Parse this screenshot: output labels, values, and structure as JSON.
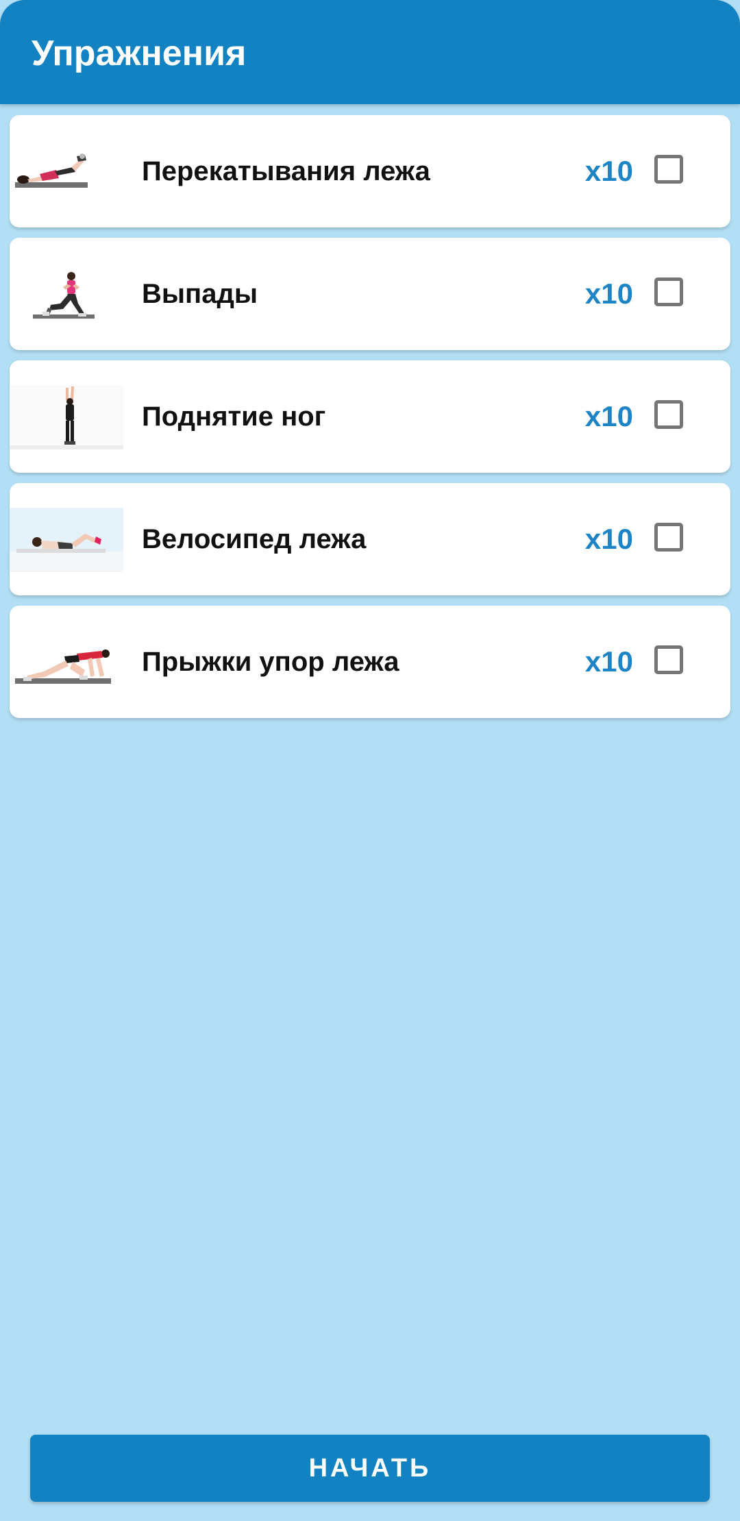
{
  "header": {
    "title": "Упражнения"
  },
  "exercises": [
    {
      "name": "Перекатывания лежа",
      "reps": "x10",
      "checked": false,
      "thumbnail_icon": "lying-roll-exercise-image"
    },
    {
      "name": "Выпады",
      "reps": "x10",
      "checked": false,
      "thumbnail_icon": "lunges-exercise-image"
    },
    {
      "name": "Поднятие ног",
      "reps": "x10",
      "checked": false,
      "thumbnail_icon": "leg-raise-exercise-image"
    },
    {
      "name": "Велосипед лежа",
      "reps": "x10",
      "checked": false,
      "thumbnail_icon": "bicycle-crunch-exercise-image"
    },
    {
      "name": "Прыжки упор лежа",
      "reps": "x10",
      "checked": false,
      "thumbnail_icon": "mountain-climber-exercise-image"
    }
  ],
  "start_button": {
    "label": "НАЧАТЬ"
  },
  "colors": {
    "primary": "#1282c3",
    "background": "#b3dff6",
    "reps_text": "#1d85c6",
    "card": "#ffffff",
    "checkbox_border": "#757575"
  }
}
